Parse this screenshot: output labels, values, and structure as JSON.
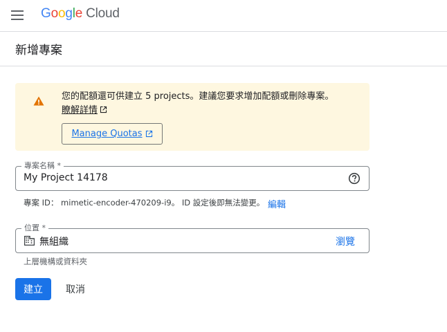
{
  "header": {
    "menu_icon": "hamburger-menu-icon",
    "logo_google": "Google",
    "logo_cloud": "Cloud",
    "logo_colors": [
      "#4285F4",
      "#EA4335",
      "#FBBC05",
      "#4285F4",
      "#34A853",
      "#EA4335"
    ]
  },
  "page": {
    "title": "新增專案"
  },
  "banner": {
    "icon": "warning-icon",
    "message": "您的配額還可供建立 5 projects。建議您要求增加配額或刪除專案。",
    "learn_more": "瞭解詳情",
    "manage_quotas": "Manage Quotas"
  },
  "project_name": {
    "label": "專案名稱 *",
    "value": "My Project 14178",
    "help_icon": "help-circle-icon"
  },
  "project_id": {
    "text": "專案 ID： mimetic-encoder-470209-i9。 ID 設定後即無法變更。",
    "edit": "編輯"
  },
  "location": {
    "label": "位置 *",
    "icon": "organization-icon",
    "value": "無組織",
    "browse": "瀏覽",
    "hint": "上層機構或資料夾"
  },
  "actions": {
    "create": "建立",
    "cancel": "取消"
  },
  "colors": {
    "accent": "#1a73e8",
    "banner_bg": "#fef7e0",
    "warning": "#e37400"
  }
}
